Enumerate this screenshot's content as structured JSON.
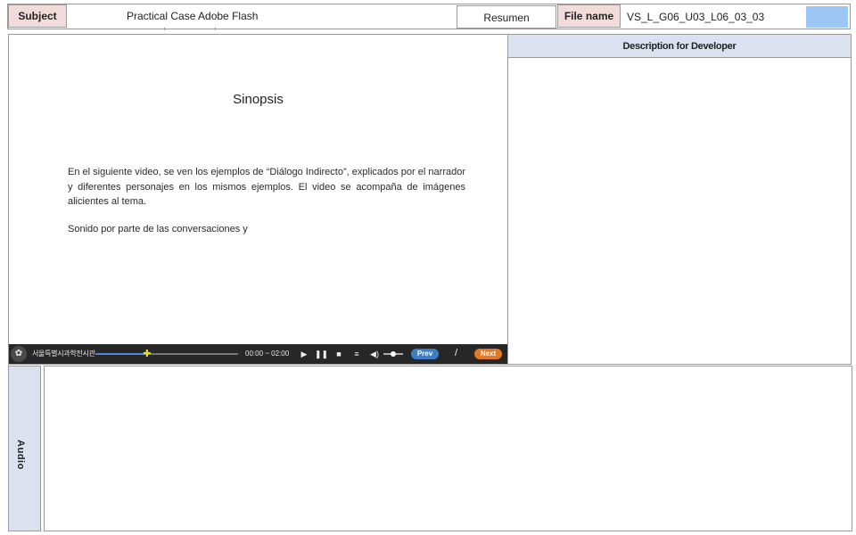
{
  "header": {
    "subject_label": "Subject",
    "subject_value": "Practical Case Adobe Flash",
    "section_value": "Resumen",
    "filename_label": "File name",
    "filename_value": "VS_L_G06_U03_L06_03_03",
    "swatch_color": "#9cc7f5"
  },
  "screen": {
    "title": "Sinopsis",
    "paragraphs": [
      "En el siguiente video, se ven los ejemplos de “Diálogo Indirecto”, explicados por el narrador  y diferentes personajes en los mismos ejemplos. El video se acompaña de imágenes alicientes al tema.",
      "Sonido por parte de las conversaciones y"
    ]
  },
  "player": {
    "organization": "서울특별시과학전시관",
    "time": "00:00 ~ 02:00",
    "progress": 0.37,
    "volume": 0.5,
    "page_separator": "/",
    "prev_label": "Prev",
    "next_label": "Next",
    "icons": {
      "logo": "emblem-icon",
      "seek": "puzzle-piece-icon",
      "play": "play-icon",
      "pause": "pause-icon",
      "stop": "stop-icon",
      "menu": "menu-icon",
      "volume": "volume-icon"
    }
  },
  "developer": {
    "header": "Description for Developer"
  },
  "audio": {
    "label": "Audio"
  },
  "colors": {
    "label_bg": "#f2dcdb",
    "panel_header_bg": "#dbe1ee",
    "player_bg": "#272727",
    "prev_button": "#3b7fc6",
    "next_button": "#e37a23",
    "seek_fill": "#4f86d6"
  }
}
